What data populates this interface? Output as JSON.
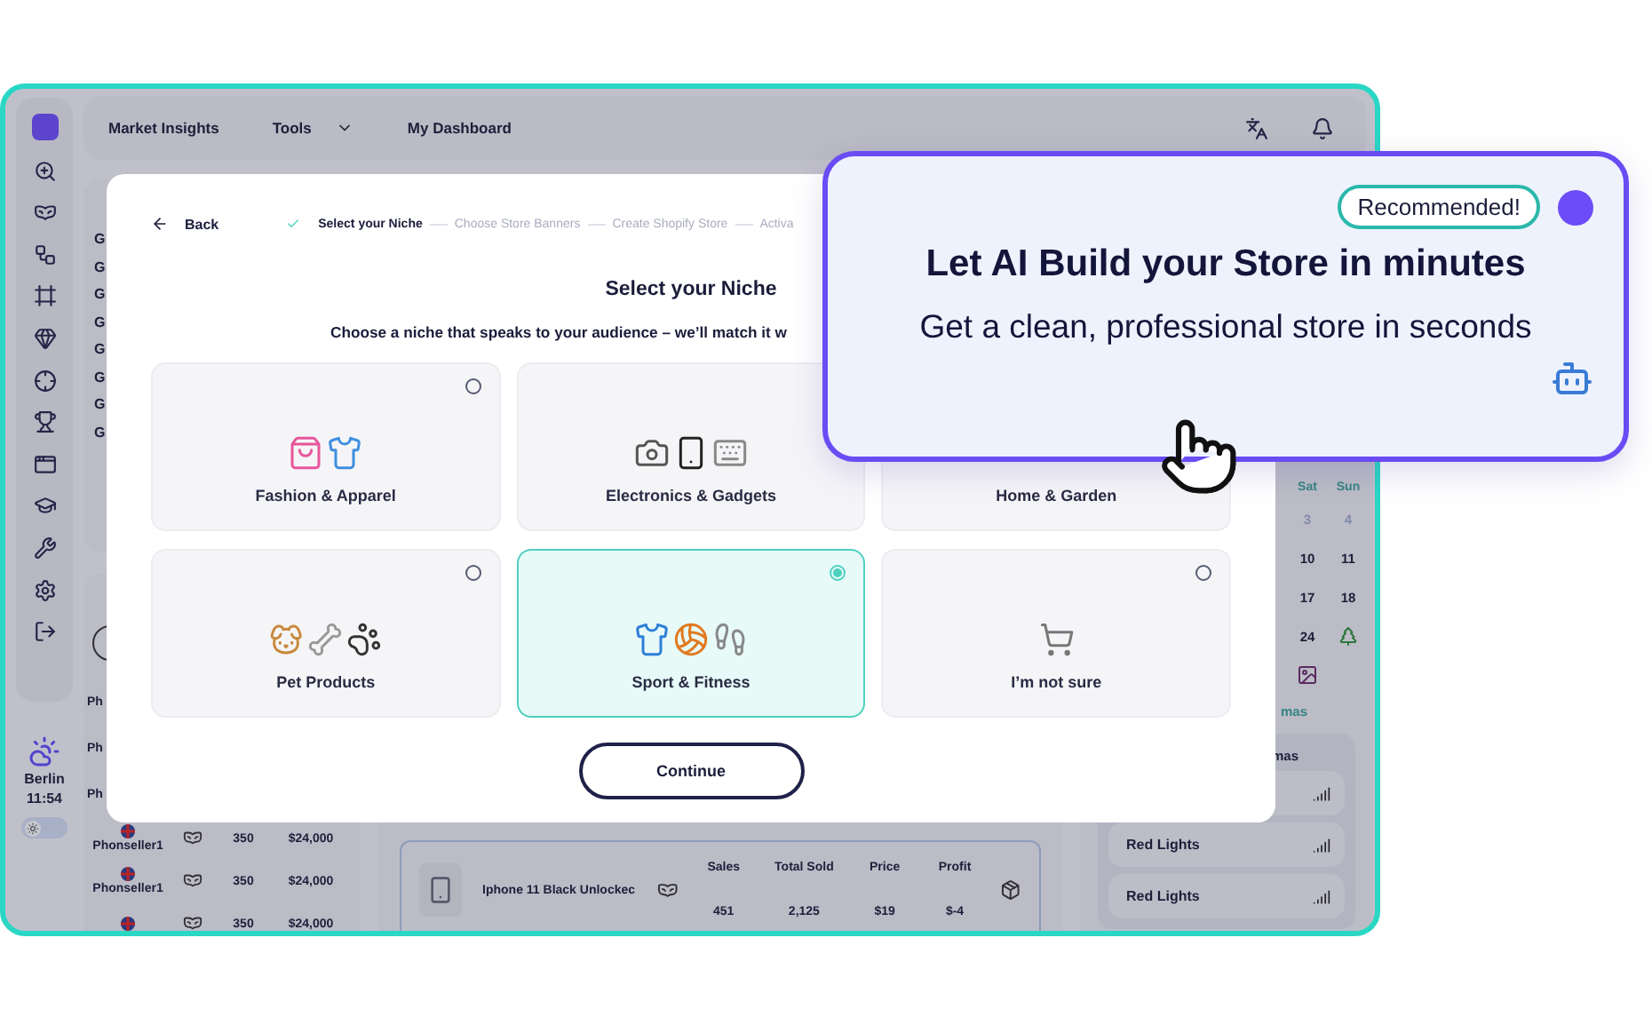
{
  "topnav": {
    "items": [
      {
        "label": "Market Insights",
        "dropdown": false
      },
      {
        "label": "Tools",
        "dropdown": true
      },
      {
        "label": "My Dashboard",
        "dropdown": false
      }
    ]
  },
  "weather": {
    "city": "Berlin",
    "time": "11:54"
  },
  "theme_toggle": {
    "on": false
  },
  "groups": [
    "G",
    "G",
    "G",
    "G",
    "G",
    "G",
    "G",
    "G"
  ],
  "sellers": [
    {
      "name": "Ph"
    },
    {
      "name": "Ph"
    },
    {
      "name": "Ph"
    },
    {
      "name": "Phonseller1",
      "count": "350",
      "amount": "$24,000"
    },
    {
      "name": "Phonseller1",
      "count": "350",
      "amount": "$24,000"
    },
    {
      "count": "350",
      "amount": "$24,000"
    }
  ],
  "product": {
    "name": "Iphone 11 Black Unlockec",
    "stats": [
      {
        "label": "Sales",
        "value": "451"
      },
      {
        "label": "Total Sold",
        "value": "2,125"
      },
      {
        "label": "Price",
        "value": "$19"
      },
      {
        "label": "Profit",
        "value": "$-4"
      }
    ]
  },
  "calendar": {
    "days": [
      "Sat",
      "Sun"
    ],
    "cells": [
      {
        "kind": "date",
        "text": "3",
        "muted": true
      },
      {
        "kind": "date",
        "text": "4",
        "muted": true
      },
      {
        "kind": "date",
        "text": "10",
        "muted": false
      },
      {
        "kind": "date",
        "text": "11",
        "muted": false
      },
      {
        "kind": "date",
        "text": "17",
        "muted": false
      },
      {
        "kind": "date",
        "text": "18",
        "muted": false
      },
      {
        "kind": "date",
        "text": "24",
        "muted": false
      },
      {
        "kind": "tree"
      },
      {
        "kind": "photo"
      }
    ],
    "caption": "mas"
  },
  "lights": {
    "title": "mas",
    "rows": [
      {
        "kind": "icon_only"
      },
      {
        "kind": "named",
        "name": "Red Lights"
      },
      {
        "kind": "named",
        "name": "Red Lights"
      }
    ]
  },
  "modal": {
    "back": "Back",
    "steps": [
      {
        "label": "Select your Niche",
        "done": true
      },
      {
        "label": "Choose Store Banners",
        "done": false
      },
      {
        "label": "Create Shopify Store",
        "done": false
      },
      {
        "label": "Activa",
        "done": false
      }
    ],
    "title": "Select your Niche",
    "subtitle": "Choose a niche that speaks to your audience – we’ll match it w",
    "niches": [
      {
        "kind": "fashion",
        "label": "Fashion & Apparel",
        "selected": false
      },
      {
        "kind": "electronics",
        "label": "Electronics & Gadgets",
        "selected": false
      },
      {
        "kind": "home",
        "label": "Home & Garden",
        "selected": false
      },
      {
        "kind": "pets",
        "label": "Pet Products",
        "selected": false
      },
      {
        "kind": "sport",
        "label": "Sport & Fitness",
        "selected": true
      },
      {
        "kind": "unsure",
        "label": "I’m not sure",
        "selected": false
      }
    ],
    "continue": "Continue"
  },
  "popup": {
    "badge": "Recommended!",
    "title": "Let AI Build your Store in minutes",
    "subtitle": "Get a clean, professional store in seconds"
  }
}
